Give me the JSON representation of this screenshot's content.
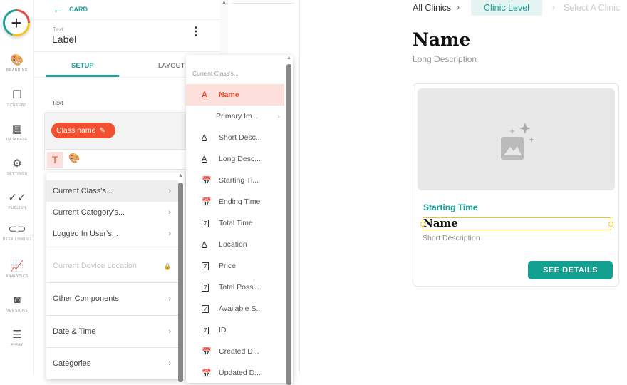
{
  "nav": {
    "items": [
      {
        "label": "BRANDING",
        "icon": "palette-icon",
        "glyph": "🎨"
      },
      {
        "label": "SCREENS",
        "icon": "screens-icon",
        "glyph": "❐"
      },
      {
        "label": "DATABASE",
        "icon": "database-icon",
        "glyph": "▦"
      },
      {
        "label": "SETTINGS",
        "icon": "gear-icon",
        "glyph": "⚙"
      },
      {
        "label": "PUBLISH",
        "icon": "publish-icon",
        "glyph": "✓✓"
      },
      {
        "label": "DEEP LINKING",
        "icon": "link-icon",
        "glyph": "⊂⊃"
      },
      {
        "label": "ANALYTICS",
        "icon": "analytics-icon",
        "glyph": "📈"
      },
      {
        "label": "VERSIONS",
        "icon": "versions-icon",
        "glyph": "◙"
      },
      {
        "label": "X-RAY",
        "icon": "sliders-icon",
        "glyph": "☰"
      }
    ]
  },
  "panel": {
    "back_label": "CARD",
    "component_type": "Text",
    "component_name": "Label",
    "tabs": [
      "SETUP",
      "LAYOUT"
    ],
    "field_label": "Text",
    "chip_label": "Class name"
  },
  "menu1": {
    "items": [
      {
        "label": "Current Class's...",
        "chevron": true
      },
      {
        "label": "Current Category's...",
        "chevron": true
      },
      {
        "label": "Logged In User's...",
        "chevron": true
      },
      {
        "label": "Current Device Location",
        "locked": true
      },
      {
        "label": "Other Components",
        "chevron": true
      },
      {
        "label": "Date & Time",
        "chevron": true
      },
      {
        "label": "Categories",
        "chevron": true
      }
    ]
  },
  "menu2": {
    "header": "Current Class's...",
    "items": [
      {
        "label": "Name",
        "icon": "text-icon"
      },
      {
        "label": "Primary Im...",
        "icon": "none"
      },
      {
        "label": "Short Desc...",
        "icon": "text-icon"
      },
      {
        "label": "Long Desc...",
        "icon": "text-icon"
      },
      {
        "label": "Starting Ti...",
        "icon": "datetime-icon"
      },
      {
        "label": "Ending Time",
        "icon": "datetime-icon"
      },
      {
        "label": "Total Time",
        "icon": "number-icon"
      },
      {
        "label": "Location",
        "icon": "text-icon"
      },
      {
        "label": "Price",
        "icon": "number-icon"
      },
      {
        "label": "Total Possi...",
        "icon": "number-icon"
      },
      {
        "label": "Available S...",
        "icon": "number-icon"
      },
      {
        "label": "ID",
        "icon": "number-icon"
      },
      {
        "label": "Created D...",
        "icon": "datetime-icon"
      },
      {
        "label": "Updated D...",
        "icon": "datetime-icon"
      }
    ]
  },
  "preview": {
    "breadcrumb": [
      "All Clinics",
      "Clinic Level",
      "Select A Clinic"
    ],
    "title": "Name",
    "subtitle": "Long Description",
    "card": {
      "label": "Starting Time",
      "name": "Name",
      "description": "Short Description",
      "button": "SEE DETAILS"
    }
  },
  "colors": {
    "teal": "#1ba39c",
    "accent": "#f0502f"
  }
}
